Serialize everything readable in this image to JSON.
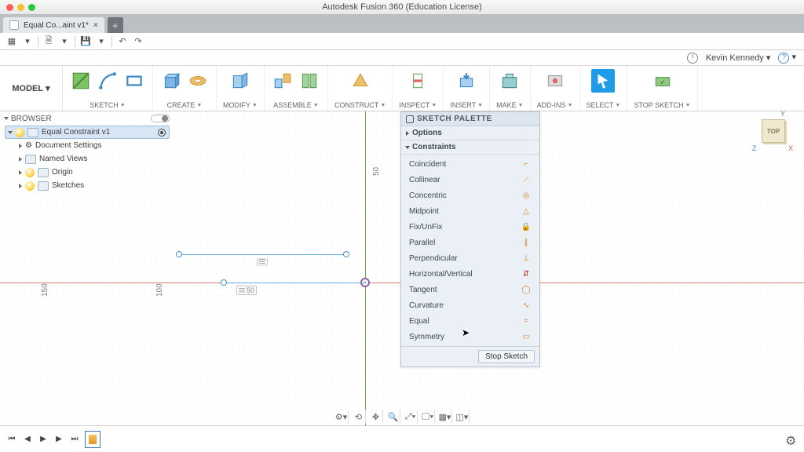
{
  "app": {
    "title": "Autodesk Fusion 360 (Education License)"
  },
  "tab": {
    "label": "Equal Co...aint v1*"
  },
  "user": {
    "name": "Kevin Kennedy",
    "menu_caret": "▾",
    "help": "?"
  },
  "model_button": "MODEL",
  "ribbon": [
    {
      "label": "SKETCH"
    },
    {
      "label": "CREATE"
    },
    {
      "label": "MODIFY"
    },
    {
      "label": "ASSEMBLE"
    },
    {
      "label": "CONSTRUCT"
    },
    {
      "label": "INSPECT"
    },
    {
      "label": "INSERT"
    },
    {
      "label": "MAKE"
    },
    {
      "label": "ADD-INS"
    },
    {
      "label": "SELECT"
    },
    {
      "label": "STOP SKETCH"
    }
  ],
  "browser": {
    "title": "BROWSER",
    "root": "Equal Constraint v1",
    "nodes": [
      "Document Settings",
      "Named Views",
      "Origin",
      "Sketches"
    ]
  },
  "palette": {
    "title": "SKETCH PALETTE",
    "sections": {
      "options": "Options",
      "constraints": "Constraints"
    },
    "constraints": [
      "Coincident",
      "Collinear",
      "Concentric",
      "Midpoint",
      "Fix/UnFix",
      "Parallel",
      "Perpendicular",
      "Horizontal/Vertical",
      "Tangent",
      "Curvature",
      "Equal",
      "Symmetry"
    ],
    "stop": "Stop Sketch"
  },
  "canvas": {
    "rulers": [
      "150",
      "100",
      "50",
      "50"
    ],
    "viewcube": "TOP",
    "axes": {
      "x": "X",
      "y": "Y",
      "z": "Z"
    }
  }
}
